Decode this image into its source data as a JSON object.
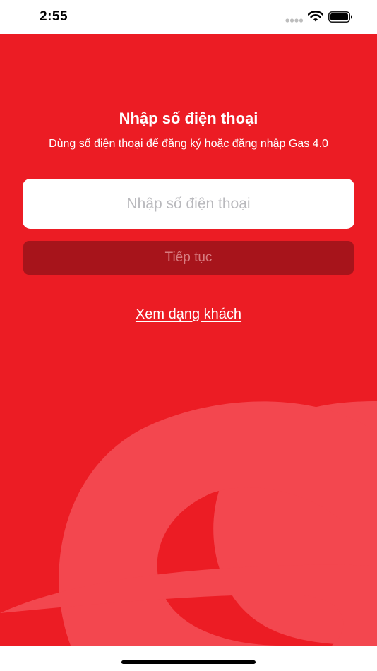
{
  "status_bar": {
    "time": "2:55"
  },
  "login": {
    "title": "Nhập số điện thoại",
    "subtitle": "Dùng số điện thoại để đăng ký hoặc đăng nhập Gas 4.0",
    "phone_placeholder": "Nhập số điện thoại",
    "phone_value": "",
    "continue_label": "Tiếp tục",
    "guest_link": "Xem dạng khách"
  },
  "colors": {
    "brand_red": "#ec1c24",
    "button_disabled": "#a7141b",
    "logo_overlay": "#f3474f"
  },
  "icons": {
    "signal": "signal-dots-icon",
    "wifi": "wifi-icon",
    "battery": "battery-icon",
    "background": "brand-logo-icon"
  }
}
